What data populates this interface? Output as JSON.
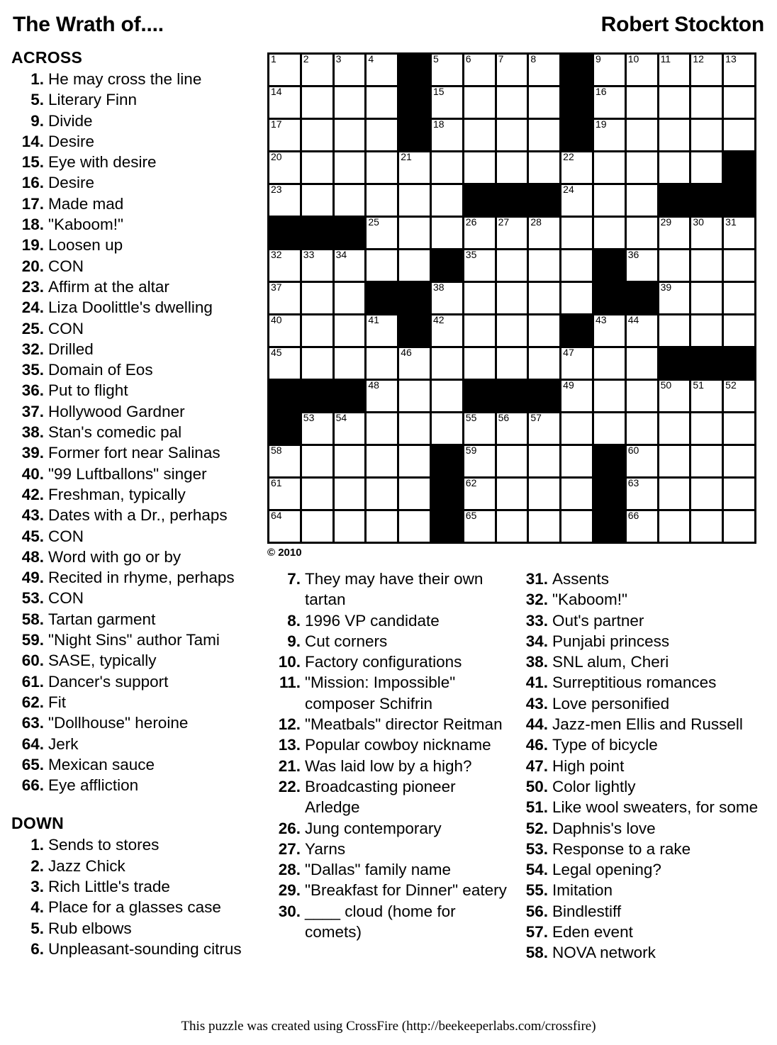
{
  "header": {
    "title": "The Wrath of....",
    "author": "Robert Stockton"
  },
  "sections": {
    "across_label": "ACROSS",
    "down_label": "DOWN"
  },
  "copyright": "© 2010",
  "footer": {
    "text": "This puzzle was created using CrossFire (http://beekeeperlabs.com/crossfire)"
  },
  "across": [
    {
      "num": "1.",
      "text": "He may cross the line"
    },
    {
      "num": "5.",
      "text": "Literary Finn"
    },
    {
      "num": "9.",
      "text": "Divide"
    },
    {
      "num": "14.",
      "text": "Desire"
    },
    {
      "num": "15.",
      "text": "Eye with desire"
    },
    {
      "num": "16.",
      "text": "Desire"
    },
    {
      "num": "17.",
      "text": "Made mad"
    },
    {
      "num": "18.",
      "text": "\"Kaboom!\""
    },
    {
      "num": "19.",
      "text": "Loosen up"
    },
    {
      "num": "20.",
      "text": "CON"
    },
    {
      "num": "23.",
      "text": "Affirm at the altar"
    },
    {
      "num": "24.",
      "text": "Liza Doolittle's dwelling"
    },
    {
      "num": "25.",
      "text": "CON"
    },
    {
      "num": "32.",
      "text": "Drilled"
    },
    {
      "num": "35.",
      "text": "Domain of Eos"
    },
    {
      "num": "36.",
      "text": "Put to flight"
    },
    {
      "num": "37.",
      "text": "Hollywood Gardner"
    },
    {
      "num": "38.",
      "text": "Stan's comedic pal"
    },
    {
      "num": "39.",
      "text": "Former fort near Salinas"
    },
    {
      "num": "40.",
      "text": "\"99 Luftballons\" singer"
    },
    {
      "num": "42.",
      "text": "Freshman, typically"
    },
    {
      "num": "43.",
      "text": "Dates with a Dr., perhaps"
    },
    {
      "num": "45.",
      "text": "CON"
    },
    {
      "num": "48.",
      "text": "Word with go or by"
    },
    {
      "num": "49.",
      "text": "Recited in rhyme, perhaps"
    },
    {
      "num": "53.",
      "text": "CON"
    },
    {
      "num": "58.",
      "text": "Tartan garment"
    },
    {
      "num": "59.",
      "text": "\"Night Sins\" author Tami"
    },
    {
      "num": "60.",
      "text": "SASE, typically"
    },
    {
      "num": "61.",
      "text": "Dancer's support"
    },
    {
      "num": "62.",
      "text": "Fit"
    },
    {
      "num": "63.",
      "text": "\"Dollhouse\" heroine"
    },
    {
      "num": "64.",
      "text": "Jerk"
    },
    {
      "num": "65.",
      "text": "Mexican sauce"
    },
    {
      "num": "66.",
      "text": "Eye affliction"
    }
  ],
  "down_col1": [
    {
      "num": "1.",
      "text": "Sends to stores"
    },
    {
      "num": "2.",
      "text": "Jazz Chick"
    },
    {
      "num": "3.",
      "text": "Rich Little's trade"
    },
    {
      "num": "4.",
      "text": "Place for a glasses case"
    },
    {
      "num": "5.",
      "text": "Rub elbows"
    },
    {
      "num": "6.",
      "text": "Unpleasant-sounding citrus"
    }
  ],
  "down_col2": [
    {
      "num": "7.",
      "text": "They may have their own tartan"
    },
    {
      "num": "8.",
      "text": "1996 VP candidate"
    },
    {
      "num": "9.",
      "text": "Cut corners"
    },
    {
      "num": "10.",
      "text": "Factory configurations"
    },
    {
      "num": "11.",
      "text": "\"Mission: Impossible\" composer Schifrin"
    },
    {
      "num": "12.",
      "text": "\"Meatbals\" director Reitman"
    },
    {
      "num": "13.",
      "text": "Popular cowboy nickname"
    },
    {
      "num": "21.",
      "text": "Was laid low by a high?"
    },
    {
      "num": "22.",
      "text": "Broadcasting pioneer Arledge"
    },
    {
      "num": "26.",
      "text": "Jung contemporary"
    },
    {
      "num": "27.",
      "text": "Yarns"
    },
    {
      "num": "28.",
      "text": "\"Dallas\" family name"
    },
    {
      "num": "29.",
      "text": "\"Breakfast for Dinner\" eatery"
    },
    {
      "num": "30.",
      "text": "____ cloud (home for comets)"
    }
  ],
  "down_col3": [
    {
      "num": "31.",
      "text": "Assents"
    },
    {
      "num": "32.",
      "text": "\"Kaboom!\""
    },
    {
      "num": "33.",
      "text": "Out's partner"
    },
    {
      "num": "34.",
      "text": "Punjabi princess"
    },
    {
      "num": "38.",
      "text": "SNL alum, Cheri"
    },
    {
      "num": "41.",
      "text": "Surreptitious romances"
    },
    {
      "num": "43.",
      "text": "Love personified"
    },
    {
      "num": "44.",
      "text": "Jazz-men Ellis and Russell"
    },
    {
      "num": "46.",
      "text": "Type of bicycle"
    },
    {
      "num": "47.",
      "text": "High point"
    },
    {
      "num": "50.",
      "text": "Color lightly"
    },
    {
      "num": "51.",
      "text": "Like wool sweaters, for some"
    },
    {
      "num": "52.",
      "text": "Daphnis's love"
    },
    {
      "num": "53.",
      "text": "Response to a rake"
    },
    {
      "num": "54.",
      "text": "Legal opening?"
    },
    {
      "num": "55.",
      "text": "Imitation"
    },
    {
      "num": "56.",
      "text": "Bindlestiff"
    },
    {
      "num": "57.",
      "text": "Eden event"
    },
    {
      "num": "58.",
      "text": "NOVA network"
    }
  ],
  "grid": {
    "cols": 15,
    "rows": 15,
    "black_color": "#000000",
    "white_color": "#ffffff",
    "rows_data": [
      {
        "blacks": [
          4,
          9
        ],
        "nums": {
          "0": "1",
          "1": "2",
          "2": "3",
          "3": "4",
          "5": "5",
          "6": "6",
          "7": "7",
          "8": "8",
          "10": "9",
          "11": "10",
          "12": "11",
          "13": "12",
          "14": "13"
        }
      },
      {
        "blacks": [
          4,
          9
        ],
        "nums": {
          "0": "14",
          "5": "15",
          "10": "16"
        }
      },
      {
        "blacks": [
          4,
          9
        ],
        "nums": {
          "0": "17",
          "5": "18",
          "10": "19"
        }
      },
      {
        "blacks": [
          14
        ],
        "nums": {
          "0": "20",
          "4": "21",
          "9": "22"
        }
      },
      {
        "blacks": [
          6,
          7,
          8,
          12,
          13,
          14
        ],
        "nums": {
          "0": "23",
          "9": "24"
        }
      },
      {
        "blacks": [
          0,
          1,
          2
        ],
        "nums": {
          "3": "25",
          "6": "26",
          "7": "27",
          "8": "28",
          "12": "29",
          "13": "30",
          "14": "31"
        }
      },
      {
        "blacks": [
          5,
          10
        ],
        "nums": {
          "0": "32",
          "1": "33",
          "2": "34",
          "6": "35",
          "11": "36"
        }
      },
      {
        "blacks": [
          3,
          4,
          10,
          11
        ],
        "nums": {
          "0": "37",
          "5": "38",
          "12": "39"
        }
      },
      {
        "blacks": [
          4,
          9
        ],
        "nums": {
          "0": "40",
          "3": "41",
          "5": "42",
          "10": "43",
          "11": "44"
        }
      },
      {
        "blacks": [
          12,
          13,
          14
        ],
        "nums": {
          "0": "45",
          "4": "46",
          "9": "47"
        }
      },
      {
        "blacks": [
          0,
          1,
          2,
          6,
          7,
          8
        ],
        "nums": {
          "3": "48",
          "9": "49",
          "12": "50",
          "13": "51",
          "14": "52"
        }
      },
      {
        "blacks": [
          0
        ],
        "nums": {
          "1": "53",
          "2": "54",
          "6": "55",
          "7": "56",
          "8": "57"
        }
      },
      {
        "blacks": [
          5,
          10
        ],
        "nums": {
          "0": "58",
          "6": "59",
          "11": "60"
        }
      },
      {
        "blacks": [
          5,
          10
        ],
        "nums": {
          "0": "61",
          "6": "62",
          "11": "63"
        }
      },
      {
        "blacks": [
          5,
          10
        ],
        "nums": {
          "0": "64",
          "6": "65",
          "11": "66"
        }
      }
    ]
  }
}
